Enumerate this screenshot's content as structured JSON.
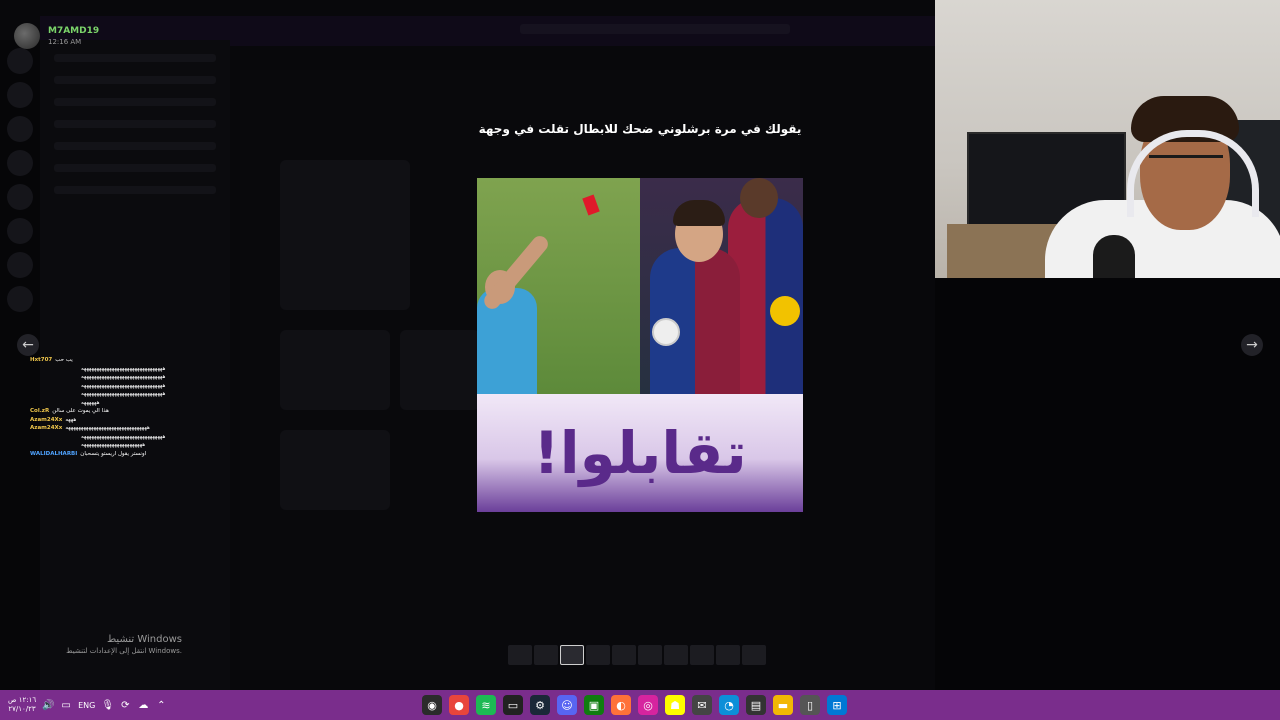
{
  "stream_user": {
    "name": "M7AMD19",
    "time": "12:16 AM"
  },
  "post": {
    "caption": "يقولك في مرة برشلوني ضحك للابطال تقلت في وجهة",
    "banner_word": "تقابلوا!"
  },
  "chat": [
    {
      "user": "Hxt707",
      "msg": "يب حب",
      "user_color": "#f2c94c"
    },
    {
      "user": "",
      "msg": "ههههههههههههههههههههههههههههههههه",
      "user_color": "#f2c94c"
    },
    {
      "user": "",
      "msg": "ههههههههههههههههههههههههههههههههه",
      "user_color": "#f2c94c"
    },
    {
      "user": "",
      "msg": "ههههههههههههههههههههههههههههههههه",
      "user_color": "#f2c94c"
    },
    {
      "user": "",
      "msg": "ههههههههههههههههههههههههههههههههه",
      "user_color": "#f2c94c"
    },
    {
      "user": "",
      "msg": "ههههههه",
      "user_color": "#f2c94c"
    },
    {
      "user": "Col.zR",
      "msg": "هذا الي يموت على سالن",
      "user_color": "#f2c94c"
    },
    {
      "user": "Azam24Xx",
      "msg": "هههه",
      "user_color": "#f2c94c"
    },
    {
      "user": "Azam24Xx",
      "msg": "ههههههههههههههههههههههههههههههههه",
      "user_color": "#f2c94c"
    },
    {
      "user": "",
      "msg": "ههههههههههههههههههههههههههههههههه",
      "user_color": "#f2c94c"
    },
    {
      "user": "",
      "msg": "ههههههههههههههههههههههههه",
      "user_color": "#f2c94c"
    },
    {
      "user": "WALIDALHARBI",
      "msg": "اونستر يقول اريستو يتسحبان",
      "user_color": "#4fa3ff"
    }
  ],
  "watermark": {
    "line1": "تنشيط Windows",
    "line2": "انتقل إلى الإعدادات لتنشيط Windows."
  },
  "taskbar": {
    "clock_time": "١٢:١٦ ص",
    "clock_date": "٢٧/١٠/٢٣",
    "lang": "ENG",
    "apps": [
      {
        "icon": "obs-icon",
        "glyph": "◉",
        "color": "#2b2b2b"
      },
      {
        "icon": "chrome-icon",
        "glyph": "●",
        "color": "#e8453c"
      },
      {
        "icon": "spotify-icon",
        "glyph": "≋",
        "color": "#1db954"
      },
      {
        "icon": "terminal-icon",
        "glyph": "▭",
        "color": "#222"
      },
      {
        "icon": "steam-icon",
        "glyph": "⚙",
        "color": "#1b2838"
      },
      {
        "icon": "discord-icon",
        "glyph": "☺",
        "color": "#5865f2"
      },
      {
        "icon": "xbox-icon",
        "glyph": "▣",
        "color": "#107c10"
      },
      {
        "icon": "firefox-icon",
        "glyph": "◐",
        "color": "#ff7139"
      },
      {
        "icon": "instagram-icon",
        "glyph": "◎",
        "color": "#d6249f"
      },
      {
        "icon": "snapchat-icon",
        "glyph": "☗",
        "color": "#fffc00"
      },
      {
        "icon": "mail-icon",
        "glyph": "✉",
        "color": "#444"
      },
      {
        "icon": "edge-icon",
        "glyph": "◔",
        "color": "#0c8fd8"
      },
      {
        "icon": "clapper-icon",
        "glyph": "▤",
        "color": "#333"
      },
      {
        "icon": "folder-icon",
        "glyph": "▬",
        "color": "#f2b705"
      },
      {
        "icon": "notepad-icon",
        "glyph": "▯",
        "color": "#555"
      },
      {
        "icon": "windows-icon",
        "glyph": "⊞",
        "color": "#0078d4"
      }
    ]
  }
}
